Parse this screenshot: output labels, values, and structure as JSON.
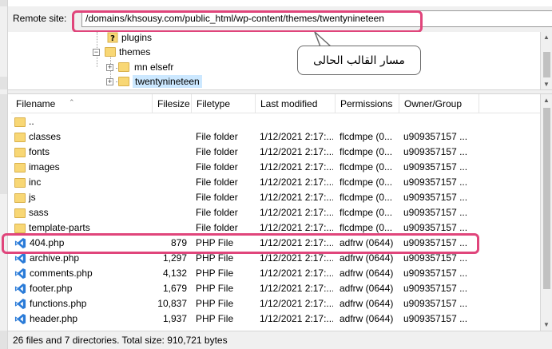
{
  "remote_site": {
    "label": "Remote site:",
    "path": "/domains/khsousy.com/public_html/wp-content/themes/twentynineteen"
  },
  "tree": {
    "nodes": [
      {
        "label": "plugins",
        "icon": "unknown-folder-icon"
      },
      {
        "label": "themes",
        "icon": "folder-icon"
      },
      {
        "label": "mn elsefr",
        "icon": "folder-icon"
      },
      {
        "label": "twentynineteen",
        "icon": "folder-icon"
      }
    ]
  },
  "callout": {
    "text": "مسار القالب الحالى"
  },
  "columns": [
    "Filename",
    "Filesize",
    "Filetype",
    "Last modified",
    "Permissions",
    "Owner/Group"
  ],
  "files": [
    {
      "name": "..",
      "size": "",
      "type": "",
      "modified": "",
      "permissions": "",
      "owner": "",
      "icon": "folder-icon"
    },
    {
      "name": "classes",
      "size": "",
      "type": "File folder",
      "modified": "1/12/2021 2:17:...",
      "permissions": "flcdmpe (0...",
      "owner": "u909357157 ...",
      "icon": "folder-icon"
    },
    {
      "name": "fonts",
      "size": "",
      "type": "File folder",
      "modified": "1/12/2021 2:17:...",
      "permissions": "flcdmpe (0...",
      "owner": "u909357157 ...",
      "icon": "folder-icon"
    },
    {
      "name": "images",
      "size": "",
      "type": "File folder",
      "modified": "1/12/2021 2:17:...",
      "permissions": "flcdmpe (0...",
      "owner": "u909357157 ...",
      "icon": "folder-icon"
    },
    {
      "name": "inc",
      "size": "",
      "type": "File folder",
      "modified": "1/12/2021 2:17:...",
      "permissions": "flcdmpe (0...",
      "owner": "u909357157 ...",
      "icon": "folder-icon"
    },
    {
      "name": "js",
      "size": "",
      "type": "File folder",
      "modified": "1/12/2021 2:17:...",
      "permissions": "flcdmpe (0...",
      "owner": "u909357157 ...",
      "icon": "folder-icon"
    },
    {
      "name": "sass",
      "size": "",
      "type": "File folder",
      "modified": "1/12/2021 2:17:...",
      "permissions": "flcdmpe (0...",
      "owner": "u909357157 ...",
      "icon": "folder-icon"
    },
    {
      "name": "template-parts",
      "size": "",
      "type": "File folder",
      "modified": "1/12/2021 2:17:...",
      "permissions": "flcdmpe (0...",
      "owner": "u909357157 ...",
      "icon": "folder-icon"
    },
    {
      "name": "404.php",
      "size": "879",
      "type": "PHP File",
      "modified": "1/12/2021 2:17:...",
      "permissions": "adfrw (0644)",
      "owner": "u909357157 ...",
      "icon": "vscode-file-icon"
    },
    {
      "name": "archive.php",
      "size": "1,297",
      "type": "PHP File",
      "modified": "1/12/2021 2:17:...",
      "permissions": "adfrw (0644)",
      "owner": "u909357157 ...",
      "icon": "vscode-file-icon"
    },
    {
      "name": "comments.php",
      "size": "4,132",
      "type": "PHP File",
      "modified": "1/12/2021 2:17:...",
      "permissions": "adfrw (0644)",
      "owner": "u909357157 ...",
      "icon": "vscode-file-icon"
    },
    {
      "name": "footer.php",
      "size": "1,679",
      "type": "PHP File",
      "modified": "1/12/2021 2:17:...",
      "permissions": "adfrw (0644)",
      "owner": "u909357157 ...",
      "icon": "vscode-file-icon"
    },
    {
      "name": "functions.php",
      "size": "10,837",
      "type": "PHP File",
      "modified": "1/12/2021 2:17:...",
      "permissions": "adfrw (0644)",
      "owner": "u909357157 ...",
      "icon": "vscode-file-icon"
    },
    {
      "name": "header.php",
      "size": "1,937",
      "type": "PHP File",
      "modified": "1/12/2021 2:17:...",
      "permissions": "adfrw (0644)",
      "owner": "u909357157 ...",
      "icon": "vscode-file-icon"
    }
  ],
  "status": "26 files and 7 directories. Total size: 910,721 bytes",
  "colors": {
    "highlight": "#e0457b",
    "folder": "#f8d775",
    "vscode": "#2a7bd8"
  }
}
